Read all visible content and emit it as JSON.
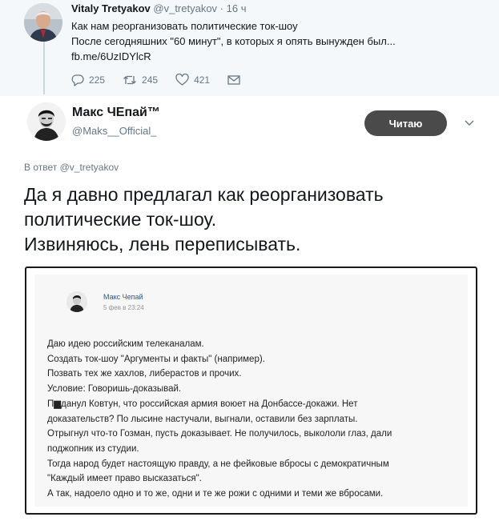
{
  "parent_tweet": {
    "author_name": "Vitaly Tretyakov",
    "author_handle": "@v_tretyakov",
    "separator": " · ",
    "time": "16 ч",
    "lines": [
      "Как нам реорганизовать политические ток-шоу",
      "После сегодняшних \"60 минут\", в которых я опять вынужден был...",
      "fb.me/6UzIDYlcR"
    ],
    "replies": "225",
    "retweets": "245",
    "likes": "421"
  },
  "main_tweet": {
    "author_name": "Макс ЧЕпай™",
    "author_handle": "@Maks__Official_",
    "follow_label": "Читаю",
    "reply_prefix": "В ответ",
    "reply_handle": "@v_tretyakov",
    "lines": [
      "Да я давно предлагал как реорганизовать",
      "политические ток-шоу.",
      "Извиняюсь, лень переписывать."
    ]
  },
  "embedded_post": {
    "author_name": "Макс Чепай",
    "date": "5 фев в 23:24",
    "lines": [
      "Даю идею российским телеканалам.",
      "Создать ток-шоу \"Аргументы и факты\" (например).",
      "Позвать тех же хахлов, либерастов и прочих.",
      "Условие: Говоришь-доказывай.",
      "П▆данул Ковтун, что российская армия воюет на Донбассе-докажи. Нет",
      "доказательств? По лысине настучали, выгнали, оставили без зарплаты.",
      "Отрыгнул что-то Гозман, пусть доказывает. Не получилось, выкололи глаз, дали",
      "поджопник из студии.",
      "Тогда народ будет настоящую правду, а не фейковые вбросы с демократичным",
      "\"Каждый имеет право высказаться\".",
      "А так, надоело одно и то же, одни и те же рожи с одними и теми же вбросами."
    ]
  },
  "icons": {
    "reply": "reply-icon",
    "retweet": "retweet-icon",
    "like": "like-icon",
    "dm": "direct-message-icon",
    "caret": "chevron-down-icon"
  },
  "colors": {
    "parent_bg": "#f5f8fa",
    "muted_text": "#657786",
    "follow_button": "#4a4a4a",
    "vk_link": "#2a5885"
  }
}
